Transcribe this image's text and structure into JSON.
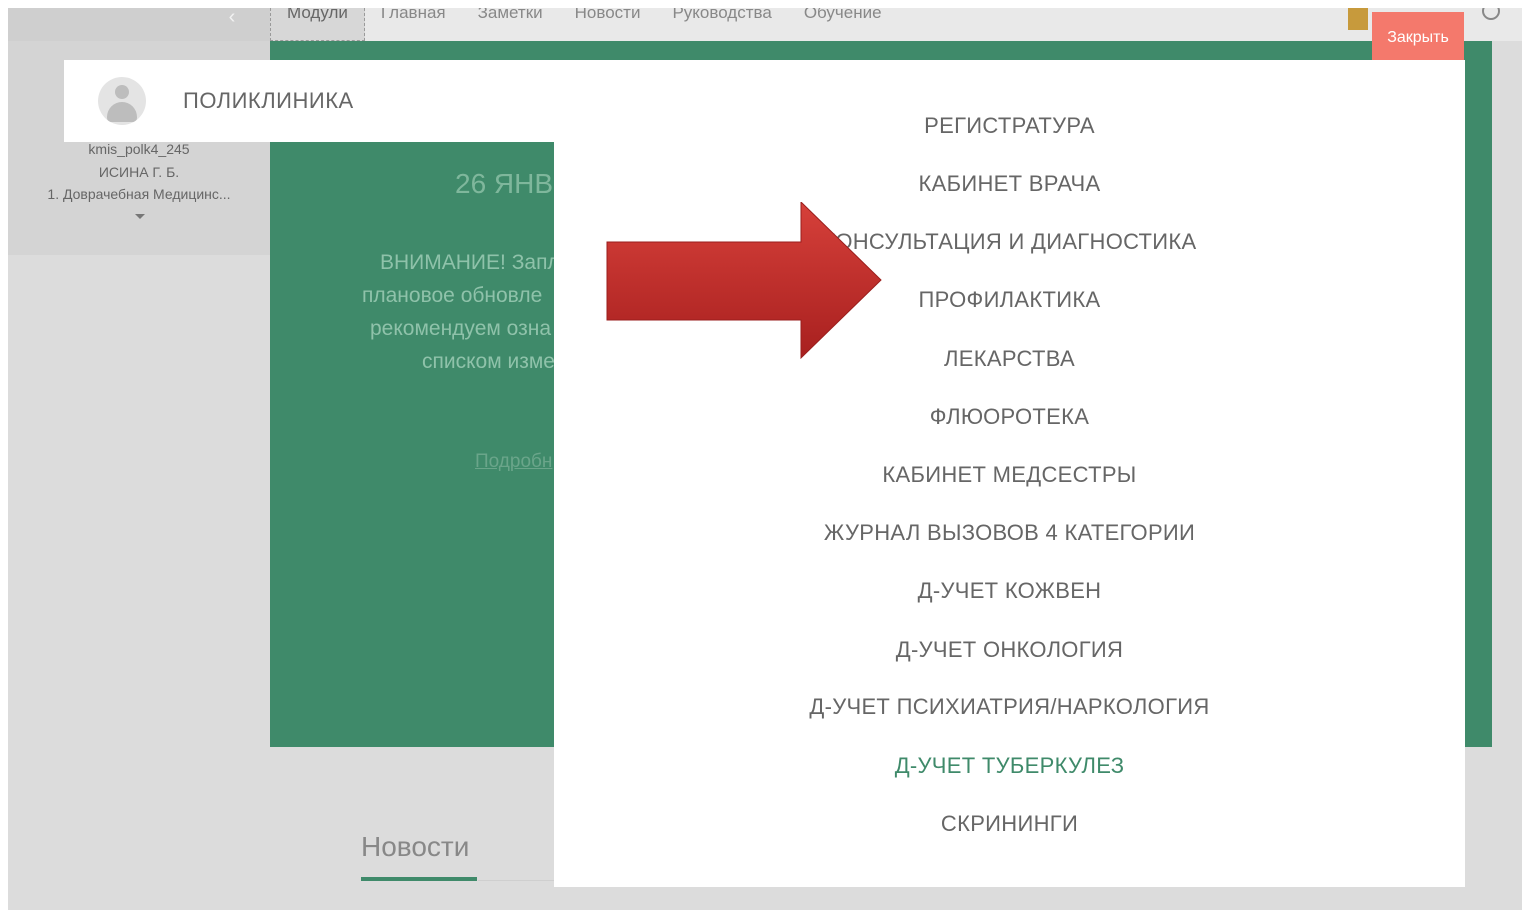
{
  "topbar": {
    "tabs": [
      {
        "label": "Модули",
        "active": true
      },
      {
        "label": "Главная"
      },
      {
        "label": "Заметки"
      },
      {
        "label": "Новости"
      },
      {
        "label": "Руководства"
      },
      {
        "label": "Обучение"
      }
    ]
  },
  "user": {
    "login": "kmis_polk4_245",
    "name": "ИСИНА Г. Б.",
    "organization": "1. Доврачебная Медицинс..."
  },
  "hero": {
    "date": "26 ЯНВ",
    "lines": [
      "ВНИМАНИЕ! Запл",
      "плановое обновле",
      "рекомендуем озна",
      "списком изме"
    ],
    "link": "Подробн"
  },
  "news": {
    "heading": "Новости"
  },
  "modal": {
    "title": "ПОЛИКЛИНИКА",
    "close_label": "Закрыть",
    "items": [
      "РЕГИСТРАТУРА",
      "КАБИНЕТ ВРАЧА",
      "КОНСУЛЬТАЦИЯ И ДИАГНОСТИКА",
      "ПРОФИЛАКТИКА",
      "ЛЕКАРСТВА",
      "ФЛЮОРОТЕКА",
      "КАБИНЕТ МЕДСЕСТРЫ",
      "ЖУРНАЛ ВЫЗОВОВ 4 КАТЕГОРИИ",
      "Д-УЧЕТ КОЖВЕН",
      "Д-УЧЕТ ОНКОЛОГИЯ",
      "Д-УЧЕТ ПСИХИАТРИЯ/НАРКОЛОГИЯ",
      "Д-УЧЕТ ТУБЕРКУЛЕЗ",
      "СКРИНИНГИ"
    ],
    "highlighted_item": "Д-УЧЕТ ТУБЕРКУЛЕЗ"
  },
  "colors": {
    "accent_green": "#3f8a6a",
    "close_button": "#f4796c",
    "arrow": "#c8322e"
  },
  "icons": {
    "module_icon": "doctor-avatar-icon",
    "back": "chevron-left-icon",
    "pointer": "red-arrow-icon"
  }
}
